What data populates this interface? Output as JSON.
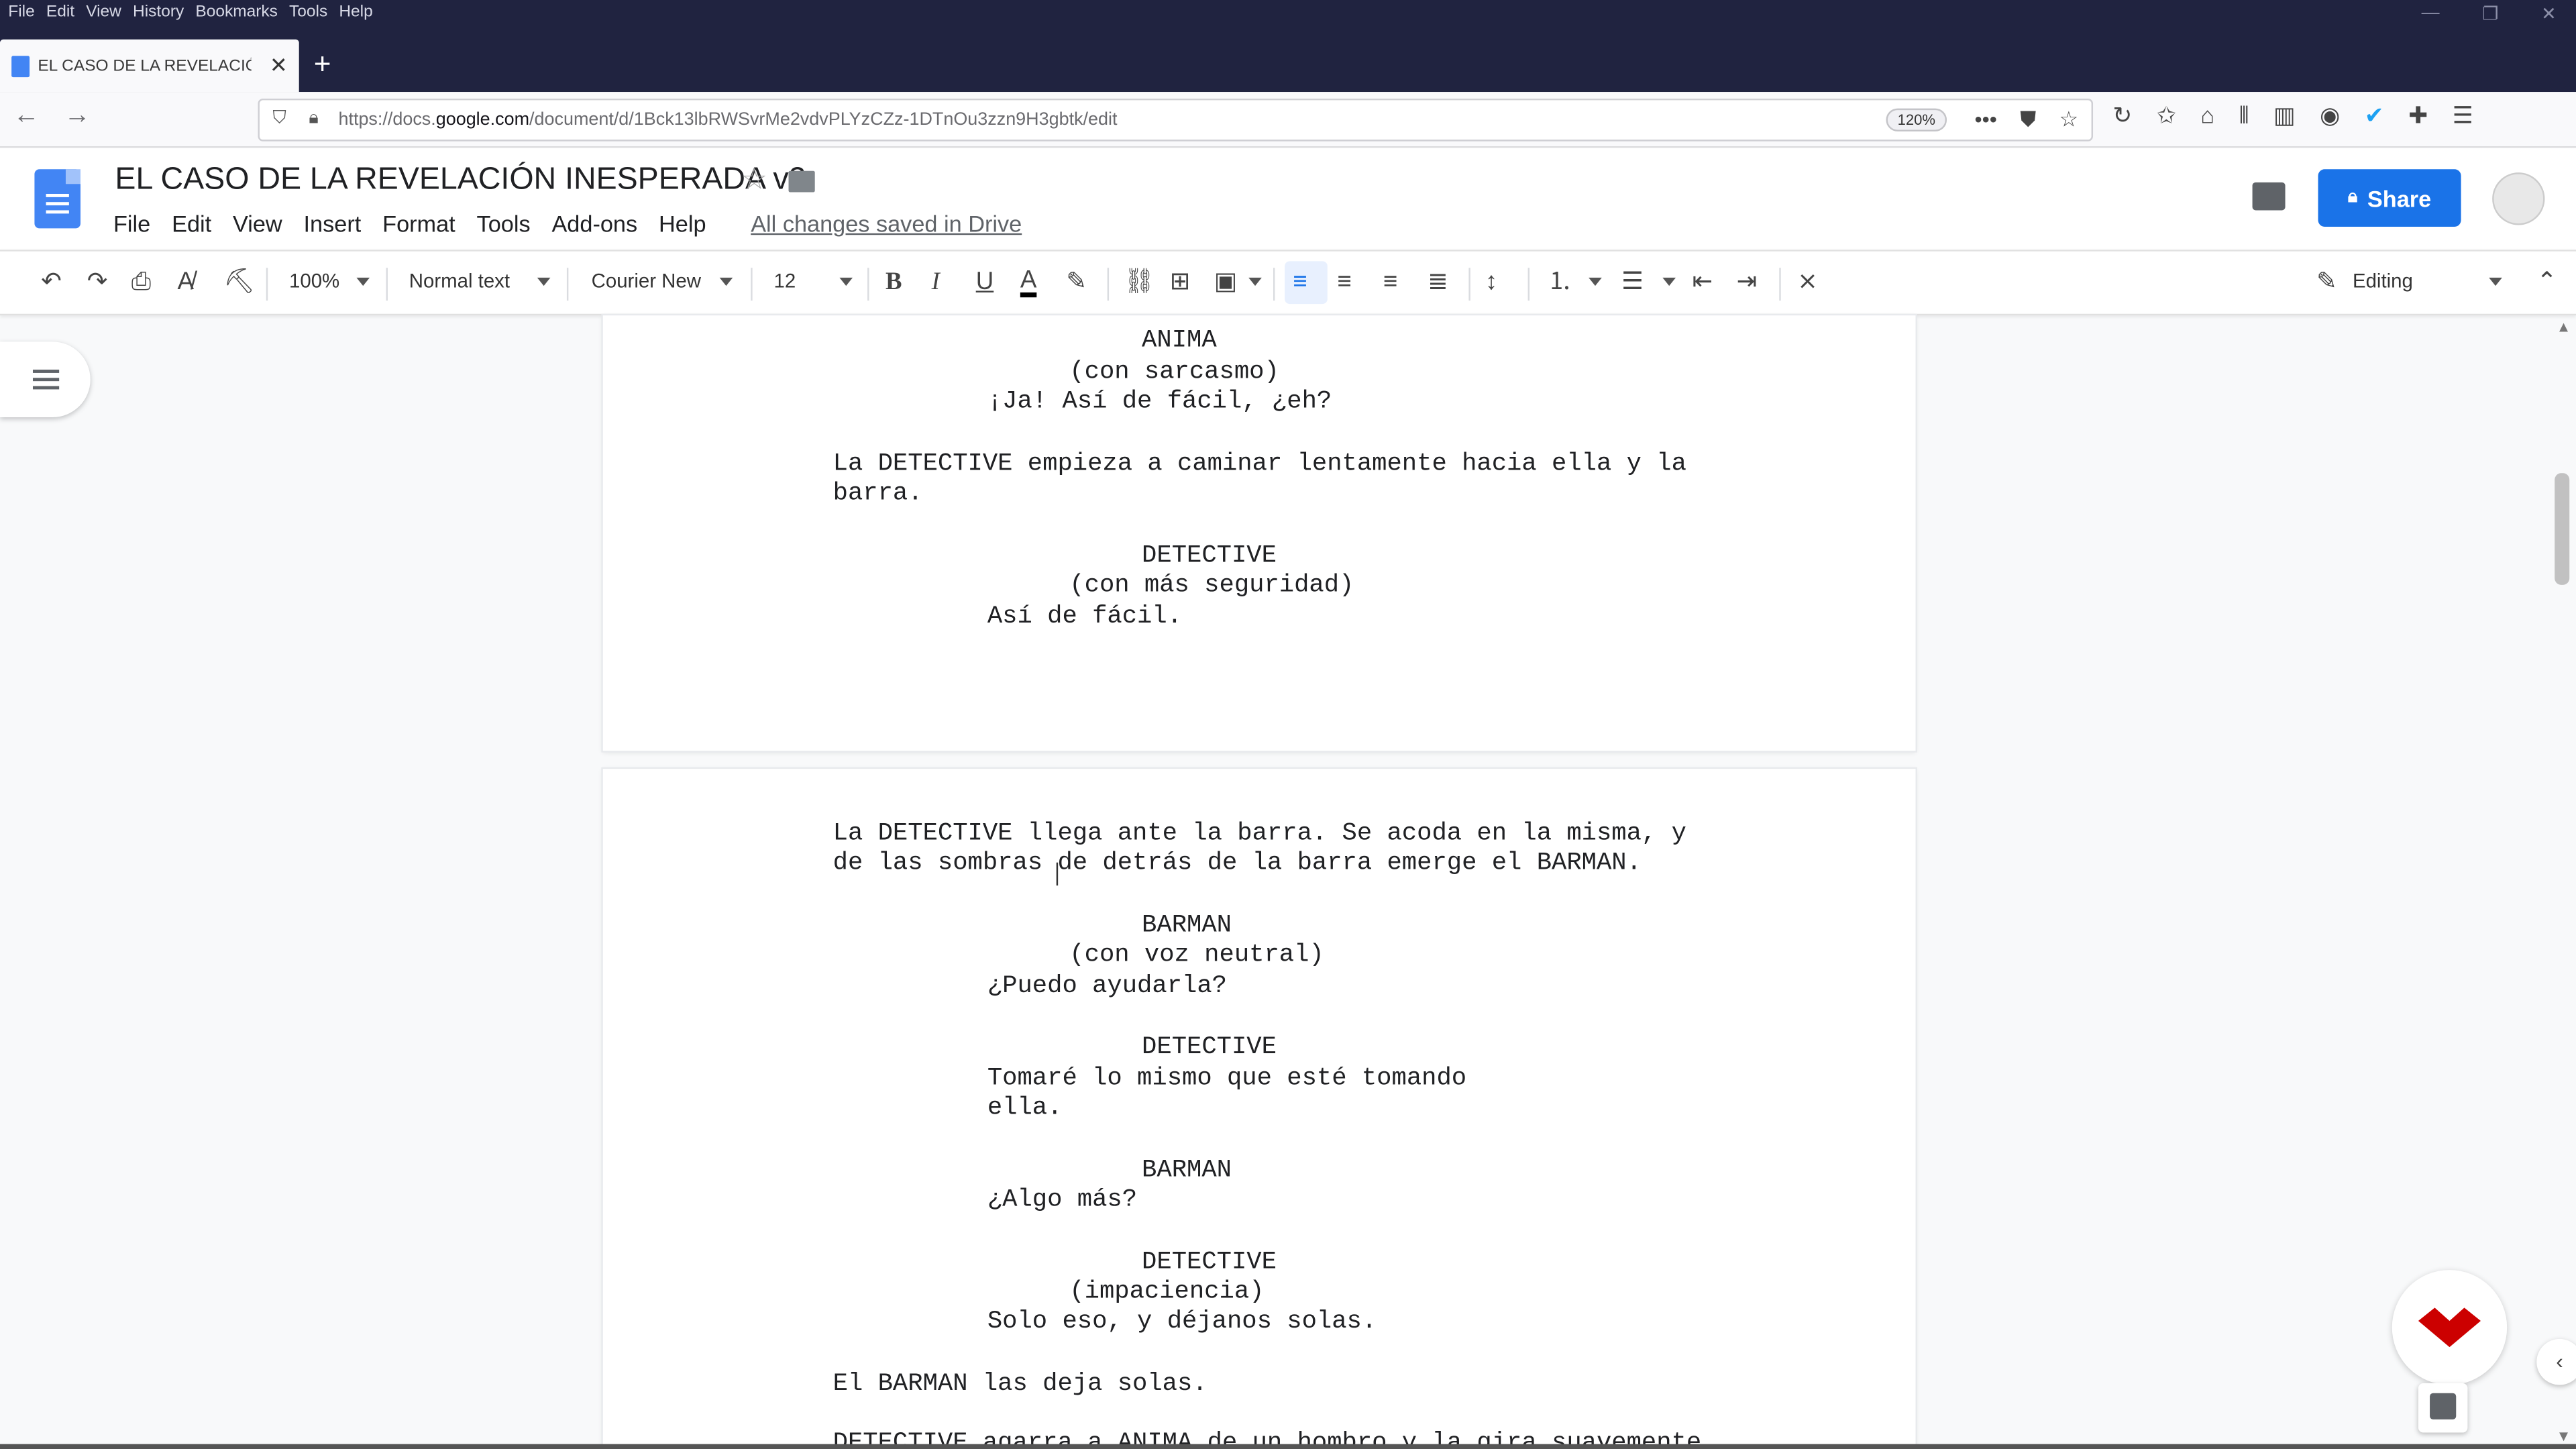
{
  "browser": {
    "menu": [
      "File",
      "Edit",
      "View",
      "History",
      "Bookmarks",
      "Tools",
      "Help"
    ],
    "tab_title": "EL CASO DE LA REVELACIÓN",
    "url_prefix": "https://docs.",
    "url_host": "google.com",
    "url_path": "/document/d/1Bck13lbRWSvrMe2vdvPLYzCZz-1DTnOu3zzn9H3gbtk/edit",
    "zoom": "120%"
  },
  "docs": {
    "title": "EL CASO DE LA REVELACIÓN INESPERADA v2",
    "menu": [
      "File",
      "Edit",
      "View",
      "Insert",
      "Format",
      "Tools",
      "Add-ons",
      "Help"
    ],
    "saved_status": "All changes saved in Drive",
    "share_label": "Share",
    "toolbar": {
      "zoom": "100%",
      "style": "Normal text",
      "font": "Courier New",
      "size": "12",
      "mode": "Editing"
    }
  },
  "page1_lines": [
    "ANIMA",
    "(con sarcasmo)",
    "¡Ja! Así de fácil, ¿eh?",
    "La DETECTIVE empieza a caminar lentamente hacia ella y la",
    "barra.",
    "DETECTIVE",
    "(con más seguridad)",
    "Así de fácil."
  ],
  "page2_lines": [
    "La DETECTIVE llega ante la barra. Se acoda en la misma, y",
    "de las sombras de detrás de la barra emerge el BARMAN.",
    "BARMAN",
    "(con voz neutral)",
    "¿Puedo ayudarla?",
    "DETECTIVE",
    "Tomaré lo mismo que esté tomando",
    "ella.",
    "BARMAN",
    "¿Algo más?",
    "DETECTIVE",
    "(impaciencia)",
    "Solo eso, y déjanos solas.",
    "El BARMAN las deja solas.",
    "DETECTIVE agarra a ANIMA de un hombro y la gira suavemente"
  ],
  "colors": {
    "share": "#1a73e8",
    "titlebar": "#202340",
    "fab_mark": "#cc0000"
  }
}
